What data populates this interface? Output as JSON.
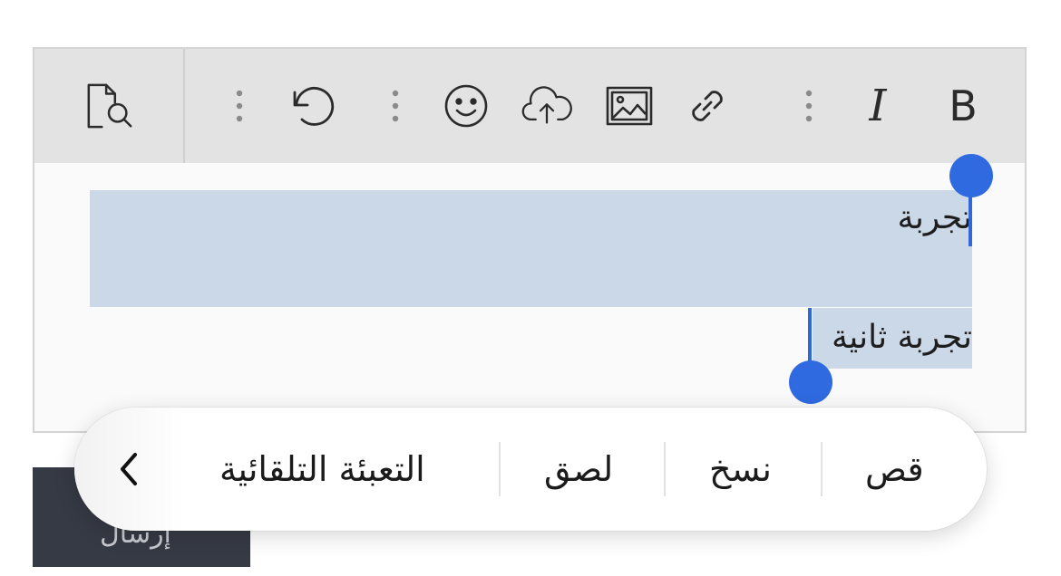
{
  "toolbar": {
    "left": [
      "preview-icon"
    ],
    "groups": [
      "more-icon",
      "undo-icon",
      "more-icon",
      "emoji-icon",
      "cloud-upload-icon",
      "image-icon",
      "link-icon",
      "more-icon",
      "italic-icon",
      "bold-icon"
    ],
    "italic_label": "I",
    "bold_label": "B"
  },
  "content": {
    "line1": "تجربة",
    "line2": "تجربة ثانية"
  },
  "colors": {
    "selection": "#cbd8e7",
    "handle": "#2f6ae0",
    "toolbar_bg": "#e3e3e3"
  },
  "context_menu": {
    "items": [
      "قص",
      "نسخ",
      "لصق",
      "التعبئة التلقائية"
    ],
    "more_icon": "chevron-left-icon"
  },
  "dark_button": {
    "label": "إرسال"
  }
}
